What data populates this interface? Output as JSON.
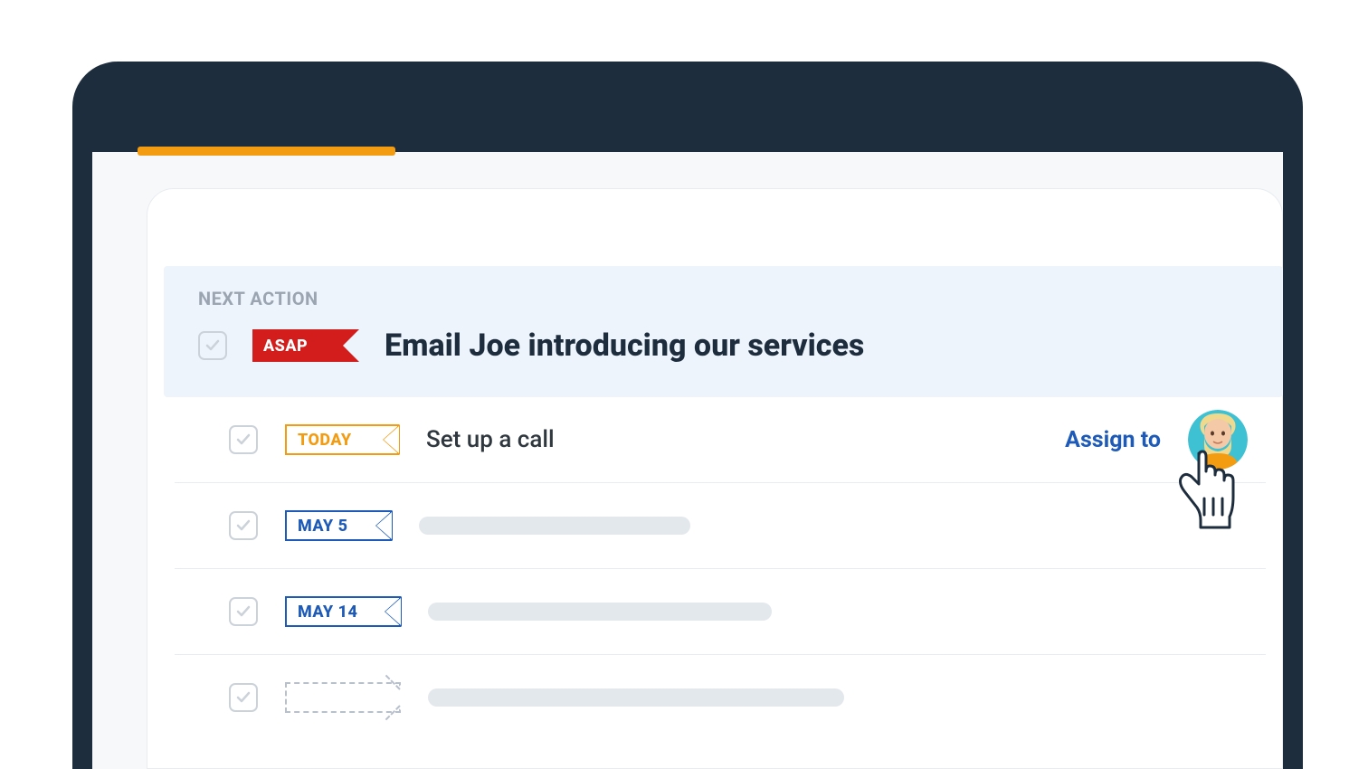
{
  "section_label": "NEXT ACTION",
  "next_action": {
    "flag": "ASAP",
    "title": "Email Joe introducing our services"
  },
  "tasks": [
    {
      "flag": "TODAY",
      "flag_style": "today",
      "title": "Set up a call",
      "assign_label": "Assign to",
      "has_avatar": true,
      "placeholder_width": 0
    },
    {
      "flag": "MAY 5",
      "flag_style": "blue",
      "title": "",
      "placeholder_width": 300
    },
    {
      "flag": "MAY 14",
      "flag_style": "blue",
      "title": "",
      "placeholder_width": 380
    },
    {
      "flag": "",
      "flag_style": "dashed",
      "title": "",
      "placeholder_width": 460
    }
  ],
  "colors": {
    "header_bg": "#1e2d3d",
    "accent_orange": "#f39c12",
    "asap_red": "#d31d1d",
    "link_blue": "#1e5bb8",
    "panel_bg": "#eef4fb"
  }
}
